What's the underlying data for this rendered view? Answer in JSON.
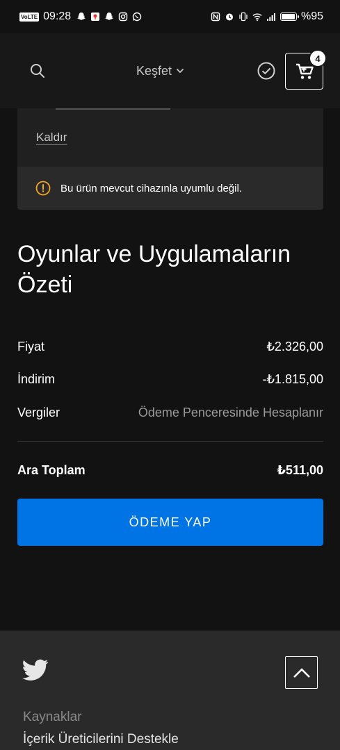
{
  "status_bar": {
    "volte": "VoLTE",
    "time": "09:28",
    "battery_text": "%95",
    "battery_level": 0.95
  },
  "nav": {
    "discover_label": "Keşfet",
    "cart_count": "4"
  },
  "cart_item": {
    "remove_label": "Kaldır",
    "warning_text": "Bu ürün mevcut cihazınla uyumlu değil."
  },
  "summary": {
    "title": "Oyunlar ve Uygulamaların Özeti",
    "price_label": "Fiyat",
    "price_value": "₺2.326,00",
    "discount_label": "İndirim",
    "discount_value": "-₺1.815,00",
    "taxes_label": "Vergiler",
    "taxes_value": "Ödeme Penceresinde Hesaplanır",
    "subtotal_label": "Ara Toplam",
    "subtotal_value": "₺511,00",
    "pay_button": "ÖDEME YAP"
  },
  "footer": {
    "resources_heading": "Kaynaklar",
    "support_creators": "İçerik Üreticilerini Destekle"
  },
  "colors": {
    "accent": "#0074e4",
    "background": "#121212",
    "card": "#202020",
    "warning": "#f5a623"
  }
}
